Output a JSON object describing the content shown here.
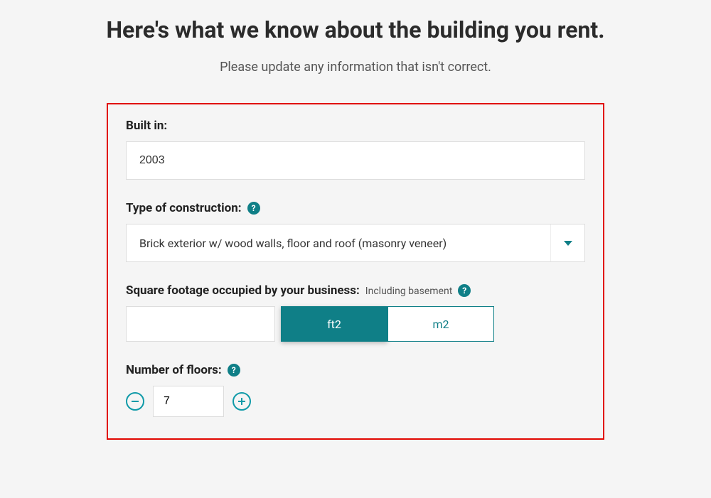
{
  "header": {
    "title": "Here's what we know about the building you rent.",
    "subtitle": "Please update any information that isn't correct."
  },
  "fields": {
    "built_in": {
      "label": "Built in:",
      "value": "2003"
    },
    "construction": {
      "label": "Type of construction:",
      "help_char": "?",
      "selected": "Brick exterior w/ wood walls, floor and roof (masonry veneer)"
    },
    "sqft": {
      "label": "Square footage occupied by your business:",
      "hint": "Including basement",
      "help_char": "?",
      "value": "",
      "unit_ft2": "ft2",
      "unit_m2": "m2"
    },
    "floors": {
      "label": "Number of floors:",
      "help_char": "?",
      "value": "7"
    }
  },
  "colors": {
    "accent": "#0f7f87",
    "error_border": "#e10600"
  }
}
